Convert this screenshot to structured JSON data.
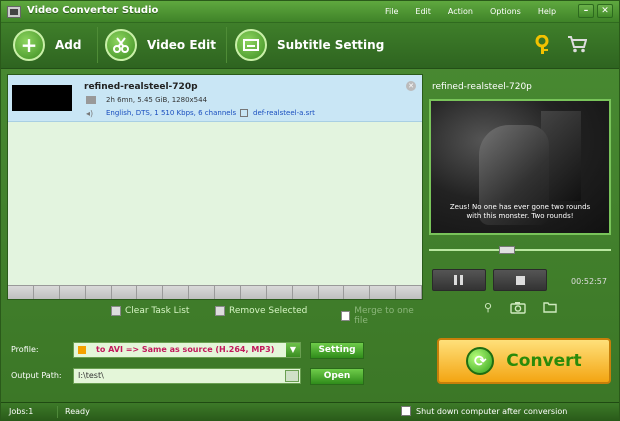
{
  "app": {
    "title": "Video Converter Studio"
  },
  "menu": [
    "File",
    "Edit",
    "Action",
    "Options",
    "Help"
  ],
  "window_controls": {
    "minimize": "–",
    "close": "✕"
  },
  "toolbar": {
    "add_label": "Add",
    "add_icon": "+",
    "video_edit_label": "Video Edit",
    "subtitle_setting_label": "Subtitle Setting"
  },
  "task": {
    "name": "refined-realsteel-720p",
    "video_info": "2h 6mn, 5.45 GiB, 1280x544",
    "audio_info": "English, DTS, 1 510 Kbps, 6 channels",
    "subtitle_file": "def-realsteel-a.srt"
  },
  "task_actions": {
    "clear": "Clear Task List",
    "remove": "Remove Selected",
    "merge": "Merge to one file"
  },
  "preview": {
    "name": "refined-realsteel-720p",
    "subtitle_line1": "Zeus! No one has ever gone two rounds",
    "subtitle_line2": "with this monster. Two rounds!",
    "time": "00:52:57",
    "seek_fraction": 0.42
  },
  "profile": {
    "label": "Profile:",
    "value": "to AVI => Same as source (H.264, MP3)",
    "setting_button": "Setting"
  },
  "output": {
    "label": "Output Path:",
    "value": "I:\\test\\",
    "open_button": "Open"
  },
  "convert": {
    "label": "Convert"
  },
  "status": {
    "jobs": "Jobs:1",
    "text": "Ready",
    "shutdown_label": "Shut down computer after conversion"
  }
}
